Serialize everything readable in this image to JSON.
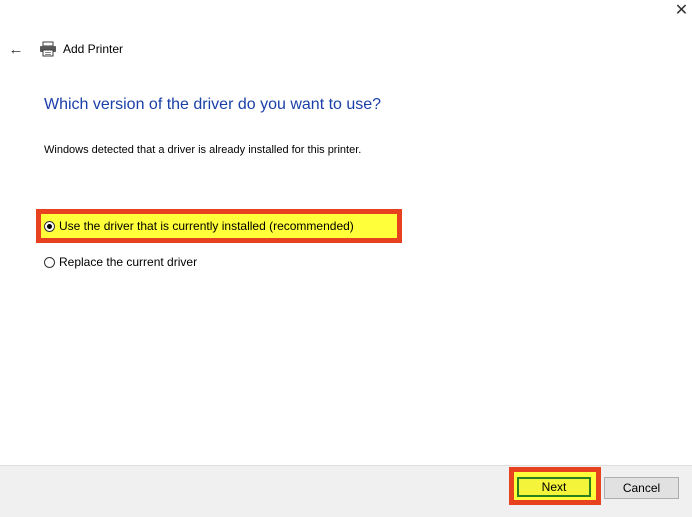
{
  "window": {
    "close_glyph": "✕",
    "title": "Add Printer",
    "back_glyph": "←",
    "icon": "printer-icon"
  },
  "main": {
    "heading": "Which version of the driver do you want to use?",
    "description": "Windows detected that a driver is already installed for this printer.",
    "options": [
      {
        "label": "Use the driver that is currently installed (recommended)",
        "selected": true
      },
      {
        "label": "Replace the current driver",
        "selected": false
      }
    ]
  },
  "footer": {
    "next_label": "Next",
    "cancel_label": "Cancel"
  },
  "colors": {
    "heading": "#1a3fa8",
    "highlight_fill": "#ffff3a",
    "highlight_border": "#e8411f",
    "footer_bg": "#f0f0f0"
  }
}
